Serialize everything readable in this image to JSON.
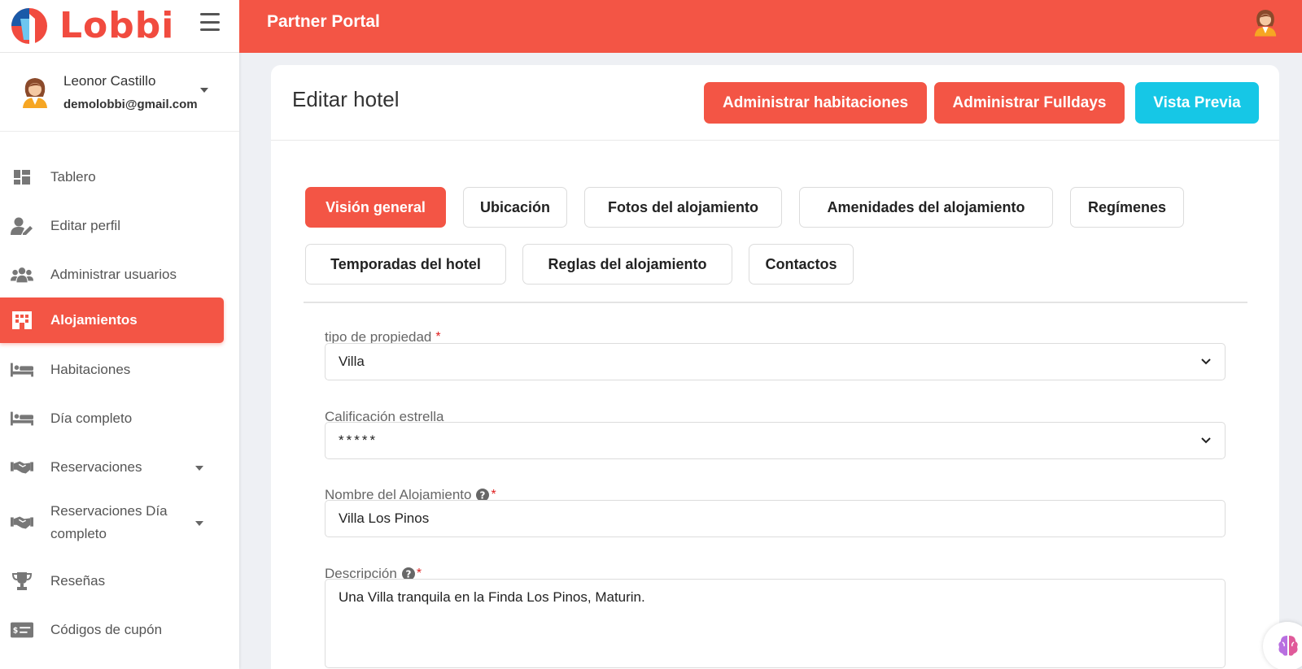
{
  "brand": {
    "name": "Lobbi"
  },
  "user": {
    "name": "Leonor Castillo",
    "email": "demolobbi@gmail.com"
  },
  "sidebar": {
    "items": [
      {
        "label": "Tablero"
      },
      {
        "label": "Editar perfil"
      },
      {
        "label": "Administrar usuarios"
      },
      {
        "label": "Alojamientos"
      },
      {
        "label": "Habitaciones"
      },
      {
        "label": "Día completo"
      },
      {
        "label": "Reservaciones"
      },
      {
        "label": "Reservaciones Día completo"
      },
      {
        "label": "Reseñas"
      },
      {
        "label": "Códigos de cupón"
      }
    ]
  },
  "header": {
    "title": "Partner Portal"
  },
  "card": {
    "title": "Editar hotel",
    "buttons": {
      "rooms": "Administrar habitaciones",
      "fulldays": "Administrar Fulldays",
      "preview": "Vista Previa"
    }
  },
  "tabs": [
    {
      "label": "Visión general"
    },
    {
      "label": "Ubicación"
    },
    {
      "label": "Fotos del alojamiento"
    },
    {
      "label": "Amenidades del alojamiento"
    },
    {
      "label": "Regímenes"
    },
    {
      "label": "Temporadas del hotel"
    },
    {
      "label": "Reglas del alojamiento"
    },
    {
      "label": "Contactos"
    }
  ],
  "form": {
    "property_type": {
      "label": "tipo de propiedad",
      "value": "Villa"
    },
    "star_rating": {
      "label": "Calificación estrella",
      "value": "*****"
    },
    "name": {
      "label": "Nombre del Alojamiento",
      "value": "Villa Los Pinos"
    },
    "description": {
      "label": "Descripción",
      "value": "Una Villa tranquila en la Finda Los Pinos, Maturin."
    },
    "required_mark": "*"
  },
  "colors": {
    "accent": "#f35545",
    "preview": "#16c7e6"
  }
}
